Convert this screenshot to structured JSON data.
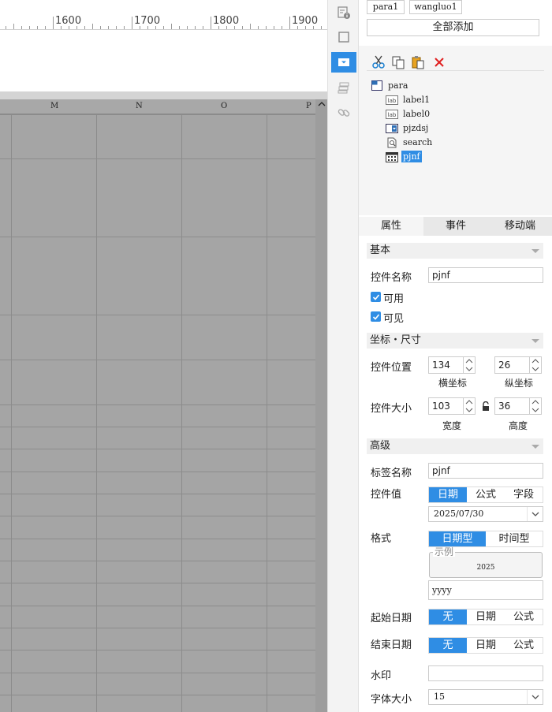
{
  "ruler": {
    "labels": [
      "1600",
      "1700",
      "1800",
      "1900"
    ]
  },
  "grid": {
    "columns": [
      "M",
      "N",
      "O",
      "P"
    ]
  },
  "params": {
    "items": [
      "para1",
      "wangluo1"
    ],
    "add_all": "全部添加"
  },
  "tree": {
    "root": "para",
    "children": [
      "label1",
      "label0",
      "pjzdsj",
      "search",
      "pjnf"
    ],
    "selected": "pjnf"
  },
  "tabs": [
    "属性",
    "事件",
    "移动端"
  ],
  "basic": {
    "section": "基本",
    "name_label": "控件名称",
    "name_value": "pjnf",
    "enabled_label": "可用",
    "visible_label": "可见"
  },
  "coords": {
    "section": "坐标・尺寸",
    "pos_label": "控件位置",
    "x": "134",
    "y": "26",
    "x_label": "横坐标",
    "y_label": "纵坐标",
    "size_label": "控件大小",
    "width": "103",
    "height": "36",
    "w_label": "宽度",
    "h_label": "高度"
  },
  "advanced": {
    "section": "高级",
    "tag_label": "标签名称",
    "tag_value": "pjnf",
    "value_label": "控件值",
    "value_options": [
      "日期",
      "公式",
      "字段"
    ],
    "value_date": "2025/07/30",
    "format_label": "格式",
    "format_options": [
      "日期型",
      "时间型"
    ],
    "example_label": "示例",
    "example_value": "2025",
    "format_value": "yyyy",
    "start_label": "起始日期",
    "start_options": [
      "无",
      "日期",
      "公式"
    ],
    "end_label": "结束日期",
    "end_options": [
      "无",
      "日期",
      "公式"
    ],
    "watermark_label": "水印",
    "watermark_value": "",
    "fontsize_label": "字体大小",
    "fontsize_value": "15"
  },
  "colors": {
    "accent": "#2f8de4",
    "grid": "#a5a5a5",
    "delete": "#e02020"
  }
}
